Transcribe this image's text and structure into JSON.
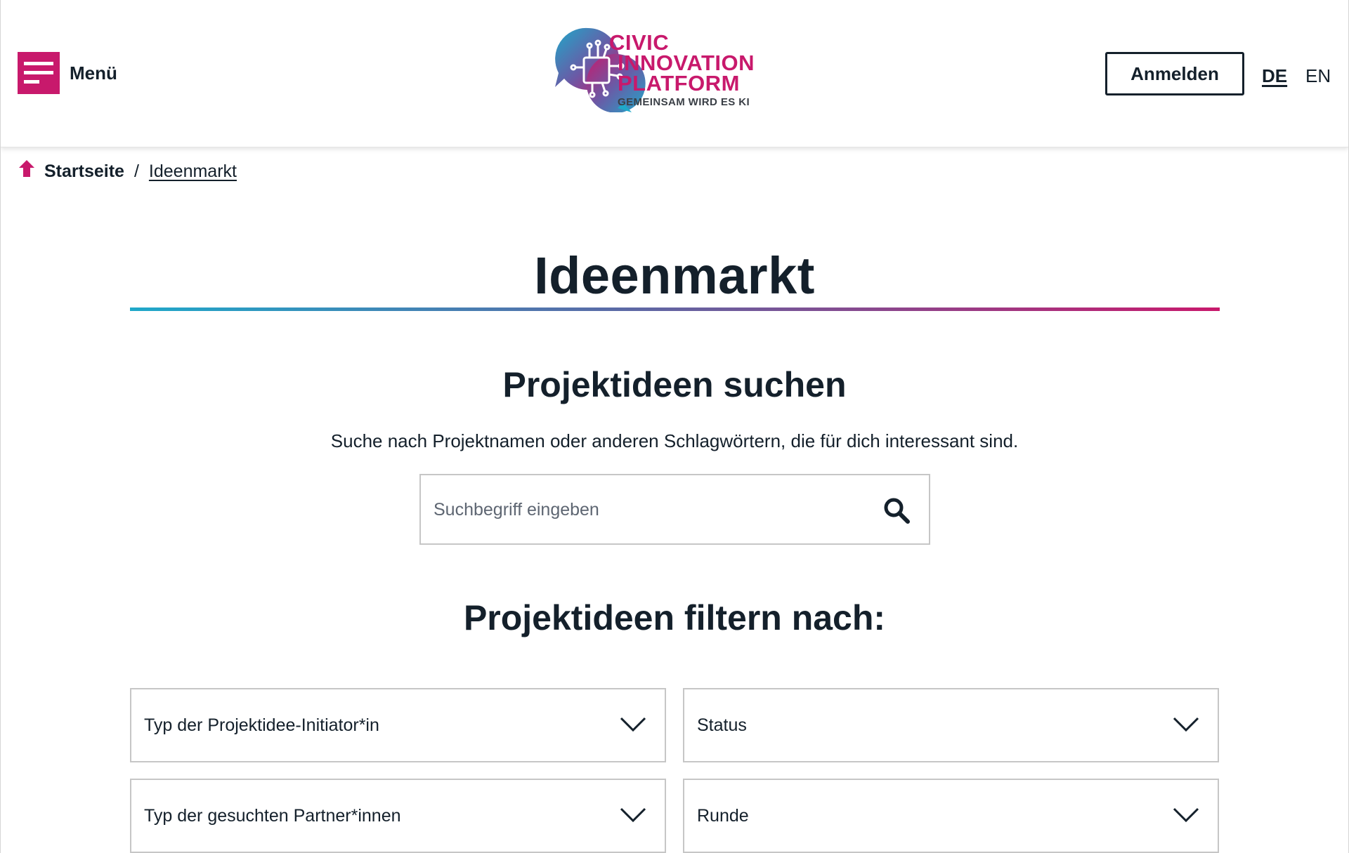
{
  "header": {
    "menu_label": "Menü",
    "logo": {
      "line1": "CIVIC",
      "line2": "INNOVATION",
      "line3": "PLATFORM",
      "tagline": "GEMEINSAM WIRD ES KI"
    },
    "login_label": "Anmelden",
    "languages": [
      {
        "code": "DE",
        "active": true
      },
      {
        "code": "EN",
        "active": false
      }
    ]
  },
  "breadcrumb": {
    "home_icon": "home-icon",
    "home_label": "Startseite",
    "separator": "/",
    "current_label": "Ideenmarkt"
  },
  "main": {
    "title": "Ideenmarkt",
    "search": {
      "heading": "Projektideen suchen",
      "description": "Suche nach Projektnamen oder anderen Schlagwörtern, die für dich interessant sind.",
      "placeholder": "Suchbegriff eingeben",
      "value": "",
      "button_icon": "search-icon"
    },
    "filter": {
      "heading": "Projektideen filtern nach:",
      "dropdowns": [
        {
          "label": "Typ der Projektidee-Initiator*in",
          "icon": "chevron-down-icon"
        },
        {
          "label": "Status",
          "icon": "chevron-down-icon"
        },
        {
          "label": "Typ der gesuchten Partner*innen",
          "icon": "chevron-down-icon"
        },
        {
          "label": "Runde",
          "icon": "chevron-down-icon"
        }
      ]
    }
  },
  "colors": {
    "brand_magenta": "#c8196c",
    "brand_teal": "#1fa8c9",
    "text_dark": "#14202b",
    "border_gray": "#c6c6c6"
  }
}
